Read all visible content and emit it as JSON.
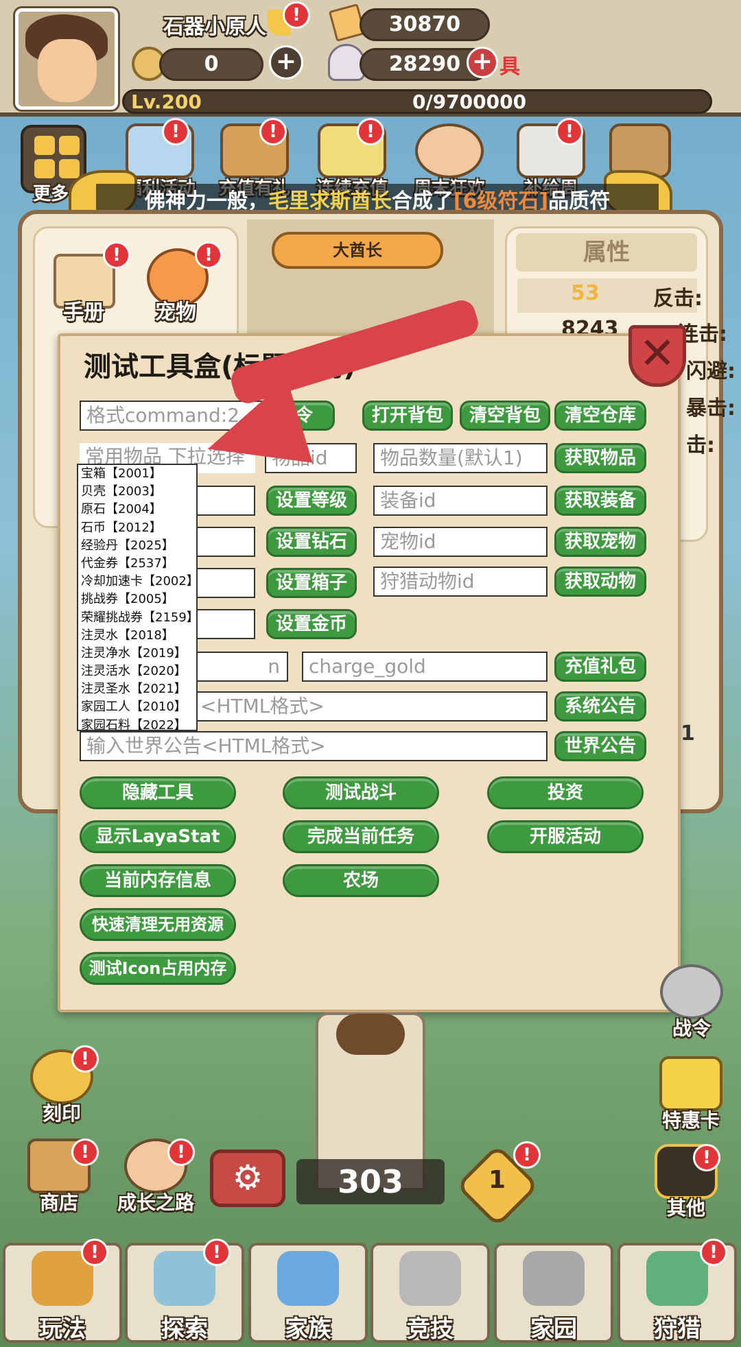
{
  "player": {
    "name": "石器小原人",
    "level": "Lv.200",
    "exp": "0/9700000",
    "currency_ticket": "30870",
    "currency_donut": "0",
    "currency_shell": "28290",
    "plus": "+",
    "tool_label": "具"
  },
  "topMenu": {
    "more": "更多",
    "items": [
      "福利活动",
      "充值有礼",
      "连续充值",
      "周末狂欢",
      "补给周",
      "补给"
    ]
  },
  "broadcast": {
    "prefix": "佛神力一般，",
    "name": "毛里求斯酋长",
    "middle": "合成了",
    "item": "[6级符石]",
    "suffix": "品质符"
  },
  "mainScreen": {
    "handbook": "手册",
    "pet": "宠物",
    "chief": "大酋长",
    "attributes_title": "属性",
    "attr_value_1": "53",
    "attr_value_2": "8243",
    "attr_label_1": "反击:",
    "attr_label_2": "连击:",
    "attr_label_3": "闪避:",
    "attr_label_4": "暴击:",
    "attr_label_5": "击:",
    "side_num": "1"
  },
  "dialog": {
    "title": "测试工具盒(标题拖动)",
    "close": "✕",
    "command_placeholder": "格式command:2",
    "send": "令",
    "open_bag": "打开背包",
    "clear_bag": "清空背包",
    "clear_warehouse": "清空仓库",
    "common_items_placeholder": "常用物品 下拉选择",
    "item_id_placeholder": "物品id",
    "item_count_placeholder": "物品数量(默认1)",
    "get_item": "获取物品",
    "set_level": "设置等级",
    "equip_id_placeholder": "装备id",
    "get_equip": "获取装备",
    "set_diamond": "设置钻石",
    "pet_id_placeholder": "宠物id",
    "get_pet": "获取宠物",
    "set_box": "设置箱子",
    "hunt_id_placeholder": "狩猎动物id",
    "get_animal": "获取动物",
    "set_gold": "设置金币",
    "charge_id_placeholder": "n",
    "charge_gold_placeholder": "charge_gold",
    "charge_gift": "充值礼包",
    "sys_notice_placeholder": "<HTML格式>",
    "sys_notice": "系统公告",
    "world_notice_placeholder": "输入世界公告<HTML格式>",
    "world_notice": "世界公告",
    "hide_tool": "隐藏工具",
    "test_battle": "测试战斗",
    "invest": "投资",
    "show_stat": "显示LayaStat",
    "finish_task": "完成当前任务",
    "server_activity": "开服活动",
    "memory_info": "当前内存信息",
    "farm": "农场",
    "quick_clean": "快速清理无用资源",
    "test_icon": "测试Icon占用内存"
  },
  "dropdown": [
    "宝箱【2001】",
    "贝壳【2003】",
    "原石【2004】",
    "石币【2012】",
    "经验丹【2025】",
    "代金券【2537】",
    "冷却加速卡【2002】",
    "挑战券【2005】",
    "荣耀挑战券【2159】",
    "注灵水【2018】",
    "注灵净水【2019】",
    "注灵活水【2020】",
    "注灵圣水【2021】",
    "家园工人【2010】",
    "家园石料【2022】"
  ],
  "sideLeft": {
    "engrave": "刻印",
    "shop": "商店",
    "growth": "成长之路"
  },
  "sideRight": {
    "battlepass": "战令",
    "special": "特惠卡",
    "other": "其他"
  },
  "center": {
    "power": "303",
    "rank": "1"
  },
  "bottomNav": [
    "玩法",
    "探索",
    "家族",
    "竞技",
    "家园",
    "狩猎"
  ],
  "colors": {
    "accent_green": "#3e9a3f",
    "alert_red": "#e2353a",
    "arrow_red": "#d9434a"
  }
}
